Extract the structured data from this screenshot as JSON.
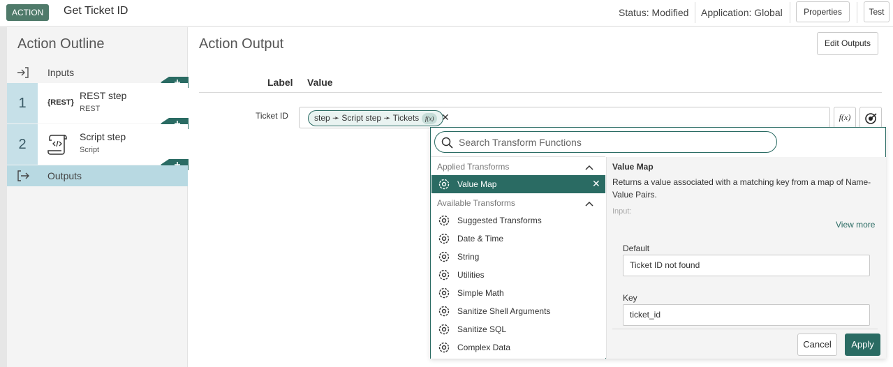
{
  "header": {
    "badge": "ACTION",
    "title": "Get Ticket ID",
    "status": "Status: Modified",
    "application": "Application: Global",
    "properties_label": "Properties",
    "test_label": "Test"
  },
  "sidebar": {
    "title": "Action Outline",
    "inputs_label": "Inputs",
    "steps": [
      {
        "number": "1",
        "name": "REST step",
        "type": "REST",
        "icon": "rest-icon",
        "icon_text": "{REST}"
      },
      {
        "number": "2",
        "name": "Script step",
        "type": "Script",
        "icon": "script-scroll-icon"
      }
    ],
    "outputs_label": "Outputs"
  },
  "main": {
    "title": "Action Output",
    "edit_outputs_label": "Edit Outputs",
    "columns": {
      "label": "Label",
      "value": "Value"
    },
    "rows": [
      {
        "label": "Ticket ID",
        "pill_text": "step ➛ Script step ➛ Tickets",
        "fx_text": "f(x)"
      }
    ],
    "fx_button_label": "f(x)"
  },
  "transform_popup": {
    "search_placeholder": "Search Transform Functions",
    "applied_heading": "Applied Transforms",
    "applied": [
      "Value Map"
    ],
    "available_heading": "Available Transforms",
    "available": [
      "Suggested Transforms",
      "Date & Time",
      "String",
      "Utilities",
      "Simple Math",
      "Sanitize Shell Arguments",
      "Sanitize SQL",
      "Complex Data"
    ],
    "detail": {
      "title": "Value Map",
      "description": "Returns a value associated with a matching key from a map of Name-Value Pairs.",
      "input_label": "Input:",
      "view_more": "View more",
      "fields": [
        {
          "label": "Default",
          "value": "Ticket ID not found"
        },
        {
          "label": "Key",
          "value": "ticket_id"
        }
      ],
      "cancel_label": "Cancel",
      "apply_label": "Apply"
    }
  },
  "colors": {
    "accent": "#2a6b63",
    "badge": "#4f7a6a",
    "step_number_bg": "#c6e0e8",
    "outputs_bg": "#b8d9e2"
  }
}
